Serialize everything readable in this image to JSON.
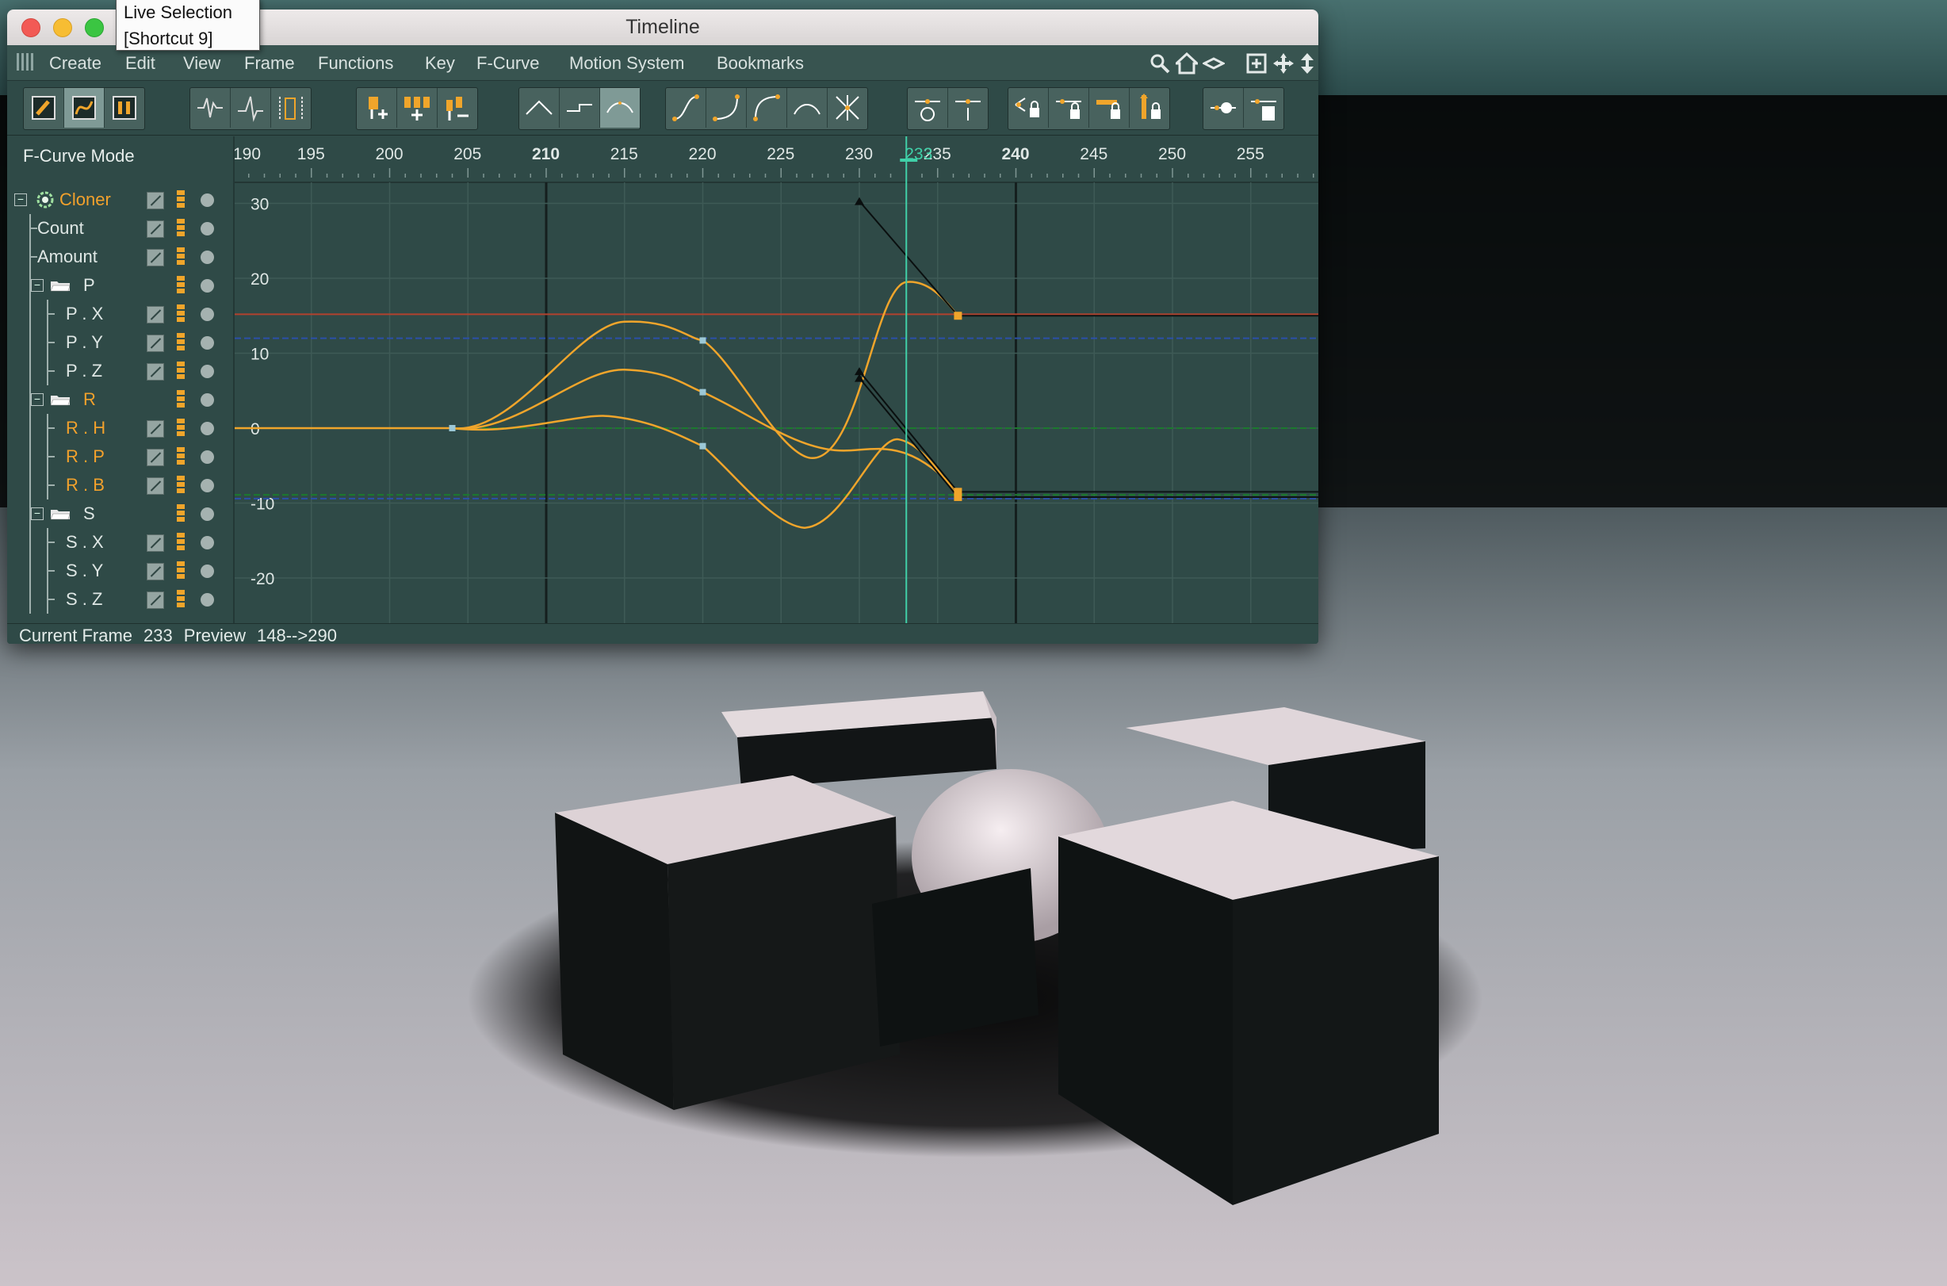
{
  "tooltip": {
    "line1": "Live Selection",
    "line2": "[Shortcut 9]"
  },
  "window": {
    "title": "Timeline"
  },
  "menubar": {
    "items": [
      "Create",
      "Edit",
      "View",
      "Frame",
      "Functions",
      "Key",
      "F-Curve",
      "Motion System",
      "Bookmarks"
    ],
    "tools": [
      "search-icon",
      "home-icon",
      "scroll-icon",
      "frame-icon",
      "move-icon",
      "vertical-move-icon"
    ]
  },
  "toolbar": {
    "groups": [
      {
        "name": "mode",
        "buttons": [
          "dope-sheet-mode-icon",
          "f-curve-mode-icon",
          "motion-mode-icon"
        ],
        "active": 1
      },
      {
        "name": "view",
        "buttons": [
          "view-waveform-icon",
          "view-spike-icon",
          "view-range-icon"
        ],
        "active": -1
      },
      {
        "name": "keys",
        "buttons": [
          "add-key-icon",
          "add-keys-icon",
          "remove-keys-icon"
        ],
        "active": -1
      },
      {
        "name": "interpolation",
        "buttons": [
          "linear-interp-icon",
          "step-interp-icon",
          "spline-interp-icon"
        ],
        "active": 2
      },
      {
        "name": "tangents",
        "buttons": [
          "ease-inout-icon",
          "ease-in-icon",
          "ease-out-icon",
          "flat-tangent-icon",
          "break-tangent-icon"
        ],
        "active": -1
      },
      {
        "name": "zero",
        "buttons": [
          "zero-angle-icon",
          "zero-length-icon"
        ],
        "active": -1
      },
      {
        "name": "locks",
        "buttons": [
          "lock-time-icon",
          "lock-value-icon",
          "lock-tangent-angle-icon",
          "lock-tangent-length-icon"
        ],
        "active": -1
      },
      {
        "name": "zero-tangent",
        "buttons": [
          "zero-angle-tangent-icon",
          "zero-length-tangent-icon"
        ],
        "active": -1
      }
    ]
  },
  "panel": {
    "mode_title": "F-Curve Mode",
    "tree": [
      {
        "label": "Cloner",
        "depth": 0,
        "orange": true,
        "type": "object",
        "expanded": true
      },
      {
        "label": "Count",
        "depth": 1,
        "orange": false,
        "type": "track"
      },
      {
        "label": "Amount",
        "depth": 1,
        "orange": false,
        "type": "track"
      },
      {
        "label": "P",
        "depth": 1,
        "orange": false,
        "type": "folder",
        "expanded": true
      },
      {
        "label": "P . X",
        "depth": 2,
        "orange": false,
        "type": "track"
      },
      {
        "label": "P . Y",
        "depth": 2,
        "orange": false,
        "type": "track"
      },
      {
        "label": "P . Z",
        "depth": 2,
        "orange": false,
        "type": "track"
      },
      {
        "label": "R",
        "depth": 1,
        "orange": true,
        "type": "folder",
        "expanded": true
      },
      {
        "label": "R . H",
        "depth": 2,
        "orange": true,
        "type": "track"
      },
      {
        "label": "R . P",
        "depth": 2,
        "orange": true,
        "type": "track"
      },
      {
        "label": "R . B",
        "depth": 2,
        "orange": true,
        "type": "track"
      },
      {
        "label": "S",
        "depth": 1,
        "orange": false,
        "type": "folder",
        "expanded": true
      },
      {
        "label": "S . X",
        "depth": 2,
        "orange": false,
        "type": "track"
      },
      {
        "label": "S . Y",
        "depth": 2,
        "orange": false,
        "type": "track"
      },
      {
        "label": "S . Z",
        "depth": 2,
        "orange": false,
        "type": "track"
      }
    ]
  },
  "graph": {
    "frame_ticks": [
      "190",
      "195",
      "200",
      "205",
      "210",
      "215",
      "220",
      "225",
      "230",
      "235",
      "240",
      "245",
      "250",
      "255"
    ],
    "bold_ticks": [
      "210",
      "240"
    ],
    "current_frame_label": "233",
    "value_ticks": [
      "30",
      "20",
      "10",
      "0",
      "-10",
      "-20"
    ],
    "colors": {
      "curve": "#f0a52b",
      "playhead": "#40d0a8",
      "red_line": "#b2422e",
      "blue_line": "#2b4fa8",
      "green_line": "#1c7a2e",
      "bg": "#2f4a47",
      "grid": "#3e5a56"
    }
  },
  "status": {
    "current_frame_label": "Current Frame",
    "current_frame_value": "233",
    "preview_label": "Preview",
    "preview_value": "148-->290"
  }
}
